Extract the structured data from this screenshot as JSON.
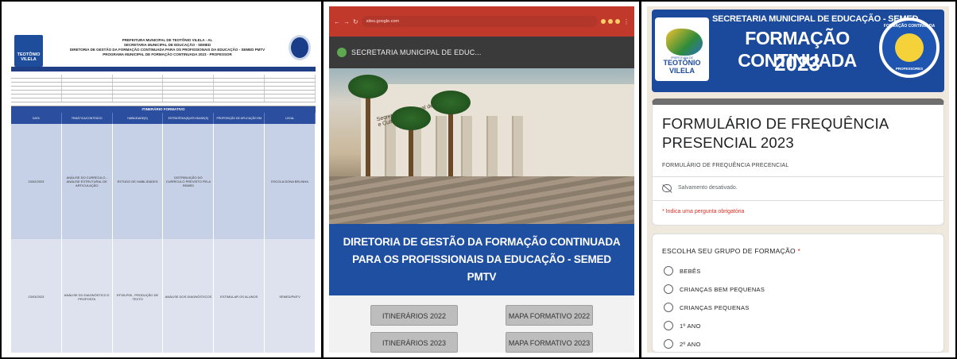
{
  "colors": {
    "form_banner_blue": "#1b4a9c",
    "site_banner_blue": "#1f4fa1",
    "browser_red": "#c0392b",
    "required_red": "#d93025"
  },
  "panel1": {
    "sheet_title_lines": [
      "PREFEITURA MUNICIPAL DE TEOTÔNIO VILELA - AL",
      "SECRETARIA MUNICIPAL DE EDUCAÇÃO - SEMED",
      "DIRETORIA DE GESTÃO DA FORMAÇÃO CONTINUADA PARA OS PROFISSIONAIS DA EDUCAÇÃO - SEMED PMTV",
      "PROGRAMA MUNICIPAL DE FORMAÇÃO CONTINUADA 2023 - PROFESSOR"
    ],
    "logo_text": "TEOTÔNIO VILELA",
    "section_header": "ITINERÁRIO FORMATIVO",
    "columns": [
      "DATA",
      "TEMÁTICA/CONTEÚDO",
      "HABILIDADE(S)",
      "ESTRATÉGIA(S)/ATIVIDADE(S)",
      "PROPOSIÇÃO DE APLICAÇÃO EM SALA",
      "LOCAL"
    ],
    "rows": [
      [
        "23/02/2023",
        "ANÁLISE DO CURRÍCULO - ANÁLISE ESTRUTURAL DE ARTICULAÇÃO",
        "ESTUDO DE HABILIDADES",
        "DISTRIBUIÇÃO DO CURRÍCULO PREVISTO PELA SEMED",
        "",
        "ESCOLA DONA BELINHA"
      ],
      [
        "23/03/2023",
        "ANÁLISE DO DIAGNÓSTICO E PROPOSTA",
        "EF15LP05 - PRODUÇÃO DE TEXTO",
        "ANÁLISE DOS DIAGNÓSTICOS",
        "ESTIMULAR OS ALUNOS",
        "SEMED/PMTV"
      ]
    ]
  },
  "panel2": {
    "url": "sites.google.com",
    "site_title": "SECRETARIA MUNICIPAL DE EDUC...",
    "building_sign": "Secretaria Municipal de Educação e Cultura",
    "banner": "DIRETORIA DE GESTÃO DA FORMAÇÃO CONTINUADA PARA OS PROFISSIONAIS DA EDUCAÇÃO - SEMED PMTV",
    "buttons": {
      "itinerarios_2022": "ITINERÁRIOS 2022",
      "mapa_2022": "MAPA FORMATIVO 2022",
      "itinerarios_2023": "ITINERÁRIOS 2023",
      "mapa_2023": "MAPA FORMATIVO 2023"
    }
  },
  "panel3": {
    "banner": {
      "secretaria": "SECRETARIA MUNICIPAL DE EDUCAÇÃO - SEMED",
      "title": "FORMAÇÃO CONTINUADA",
      "year": "2023",
      "logo_small": "PREFEITURA DE",
      "logo_name": "TEOTÔNIO VILELA",
      "seal_top": "FORMAÇÃO CONTINUADA",
      "seal_bottom": "PROFESSORES"
    },
    "form_title": "FORMULÁRIO DE FREQUÊNCIA PRESENCIAL 2023",
    "form_description": "FORMULÁRIO DE FREQUÊNCIA PRECENCIAL",
    "save_status": "Salvamento desativado.",
    "required_note": "* Indica uma pergunta obrigatória",
    "question": "ESCOLHA SEU GRUPO DE FORMAÇÃO",
    "required_mark": "*",
    "options": [
      "BEBÊS",
      "CRIANÇAS BEM PEQUENAS",
      "CRIANÇAS PEQUENAS",
      "1º ANO",
      "2º ANO"
    ]
  }
}
